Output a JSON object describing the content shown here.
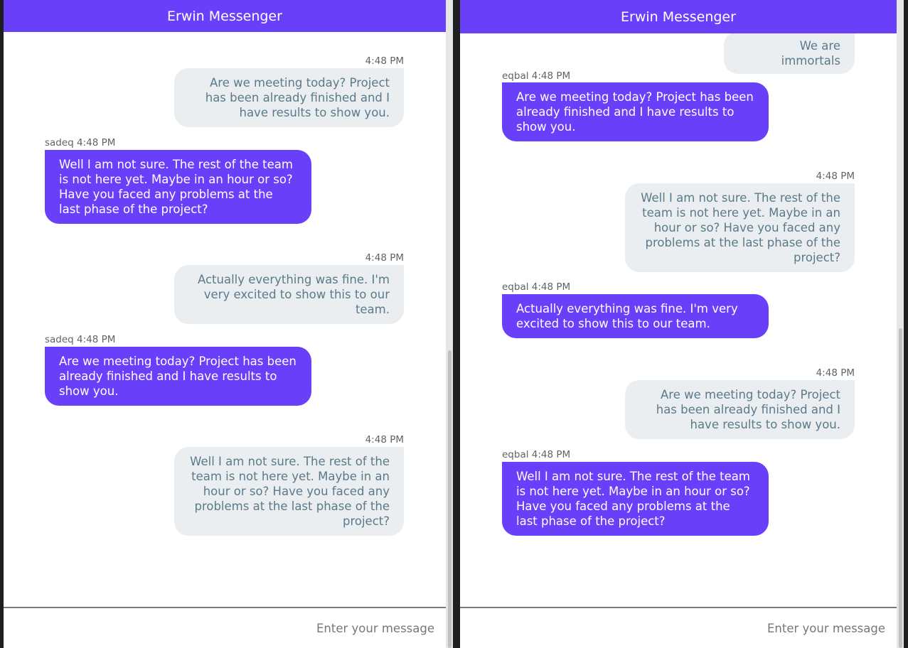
{
  "left": {
    "title": "Erwin Messenger",
    "messages": [
      {
        "meta": "4:48 PM",
        "text": "Are we meeting today? Project has been already finished and I have results to show you."
      },
      {
        "meta": "sadeq 4:48 PM",
        "text": "Well I am not sure. The rest of the team is not here yet. Maybe in an hour or so? Have you faced any problems at the last phase of the project?"
      },
      {
        "meta": "4:48 PM",
        "text": "Actually everything was fine. I'm very excited to show this to our team."
      },
      {
        "meta": "sadeq 4:48 PM",
        "text": "Are we meeting today? Project has been already finished and I have results to show you."
      },
      {
        "meta": "4:48 PM",
        "text": "Well I am not sure. The rest of the team is not here yet. Maybe in an hour or so? Have you faced any problems at the last phase of the project?"
      }
    ],
    "input_placeholder": "Enter your message"
  },
  "right": {
    "title": "Erwin Messenger",
    "messages": [
      {
        "meta": "",
        "text": "We are immortals"
      },
      {
        "meta": "eqbal 4:48 PM",
        "text": "Are we meeting today? Project has been already finished and I have results to show you."
      },
      {
        "meta": "4:48 PM",
        "text": "Well I am not sure. The rest of the team is not here yet. Maybe in an hour or so? Have you faced any problems at the last phase of the project?"
      },
      {
        "meta": "eqbal 4:48 PM",
        "text": "Actually everything was fine. I'm very excited to show this to our team."
      },
      {
        "meta": "4:48 PM",
        "text": "Are we meeting today? Project has been already finished and I have results to show you."
      },
      {
        "meta": "eqbal 4:48 PM",
        "text": "Well I am not sure. The rest of the team is not here yet. Maybe in an hour or so? Have you faced any problems at the last phase of the project?"
      }
    ],
    "input_placeholder": "Enter your message"
  },
  "colors": {
    "accent": "#6a3ff9",
    "sent_bubble": "#ebeef0",
    "sent_text": "#5a7a8a",
    "background": "#1e1f21"
  }
}
